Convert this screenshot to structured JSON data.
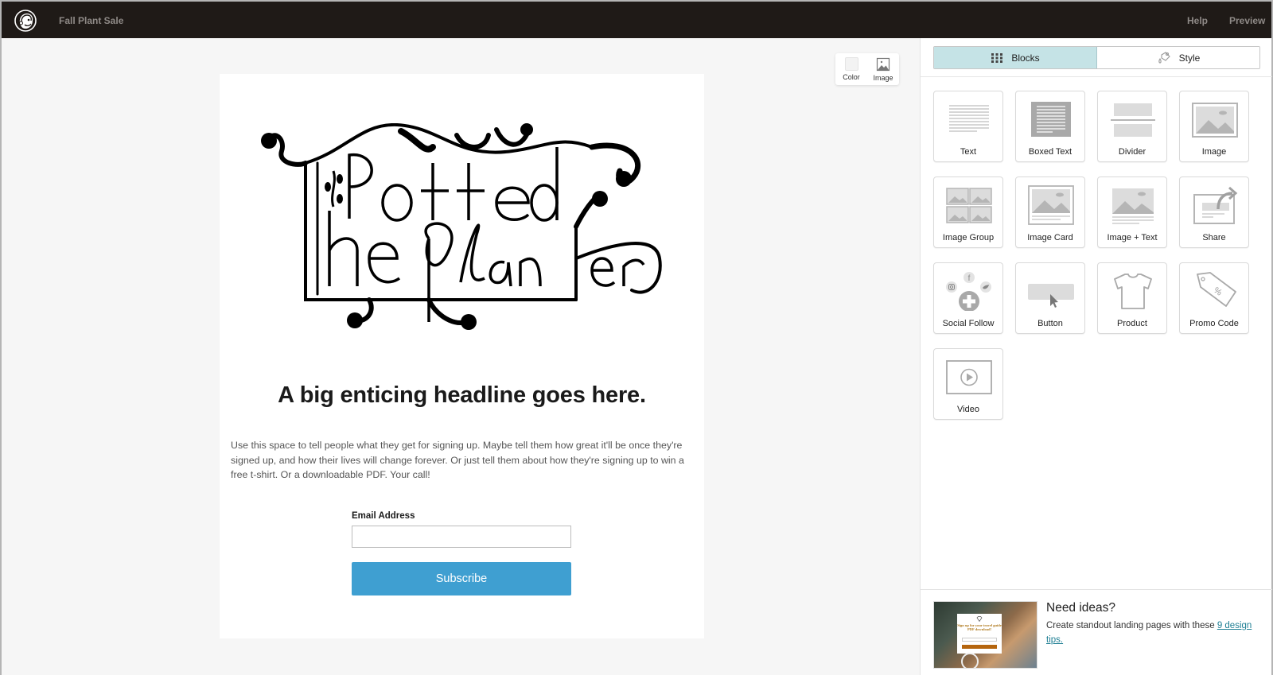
{
  "topbar": {
    "app_title": "Fall Plant Sale",
    "logo_icon": "mailchimp-freddie-logo",
    "help_label": "Help",
    "preview_label": "Preview"
  },
  "canvas": {
    "background_tools": [
      {
        "label": "Color",
        "icon": "color-swatch-icon"
      },
      {
        "label": "Image",
        "icon": "image-icon"
      }
    ],
    "page": {
      "logo_alt": "The Potted Planter",
      "logo_text_line1": "Potted",
      "logo_text_line2": "The Planter",
      "headline": "A big enticing headline goes here.",
      "body": "Use this space to tell people what they get for signing up. Maybe tell them how great it'll be once they're signed up, and how their lives will change forever. Or just tell them about how they're signing up to win a free t-shirt. Or a downloadable PDF. Your call!",
      "form": {
        "email_label": "Email Address",
        "email_value": "",
        "email_placeholder": "",
        "subscribe_label": "Subscribe"
      }
    }
  },
  "sidebar": {
    "tabs": [
      {
        "label": "Blocks",
        "icon": "grid-dots-icon",
        "active": true
      },
      {
        "label": "Style",
        "icon": "paint-bucket-icon",
        "active": false
      }
    ],
    "blocks": [
      {
        "label": "Text",
        "icon": "text-block-icon"
      },
      {
        "label": "Boxed Text",
        "icon": "boxed-text-icon"
      },
      {
        "label": "Divider",
        "icon": "divider-icon"
      },
      {
        "label": "Image",
        "icon": "image-block-icon"
      },
      {
        "label": "Image Group",
        "icon": "image-group-icon"
      },
      {
        "label": "Image Card",
        "icon": "image-card-icon"
      },
      {
        "label": "Image + Text",
        "icon": "image-text-icon"
      },
      {
        "label": "Share",
        "icon": "share-icon"
      },
      {
        "label": "Social Follow",
        "icon": "social-follow-icon"
      },
      {
        "label": "Button",
        "icon": "button-block-icon"
      },
      {
        "label": "Product",
        "icon": "tshirt-icon"
      },
      {
        "label": "Promo Code",
        "icon": "price-tag-icon"
      },
      {
        "label": "Video",
        "icon": "video-icon"
      }
    ],
    "ideas": {
      "title": "Need ideas?",
      "text": "Create standout landing pages with these ",
      "link_text": "9 design tips.",
      "thumb_caption": "Sign up for your travel guide PDF download!"
    }
  },
  "colors": {
    "topbar_bg": "#1f1a17",
    "active_tab_bg": "#c5e3e6",
    "subscribe_bg": "#3f9fd1",
    "link": "#1f7f94"
  }
}
